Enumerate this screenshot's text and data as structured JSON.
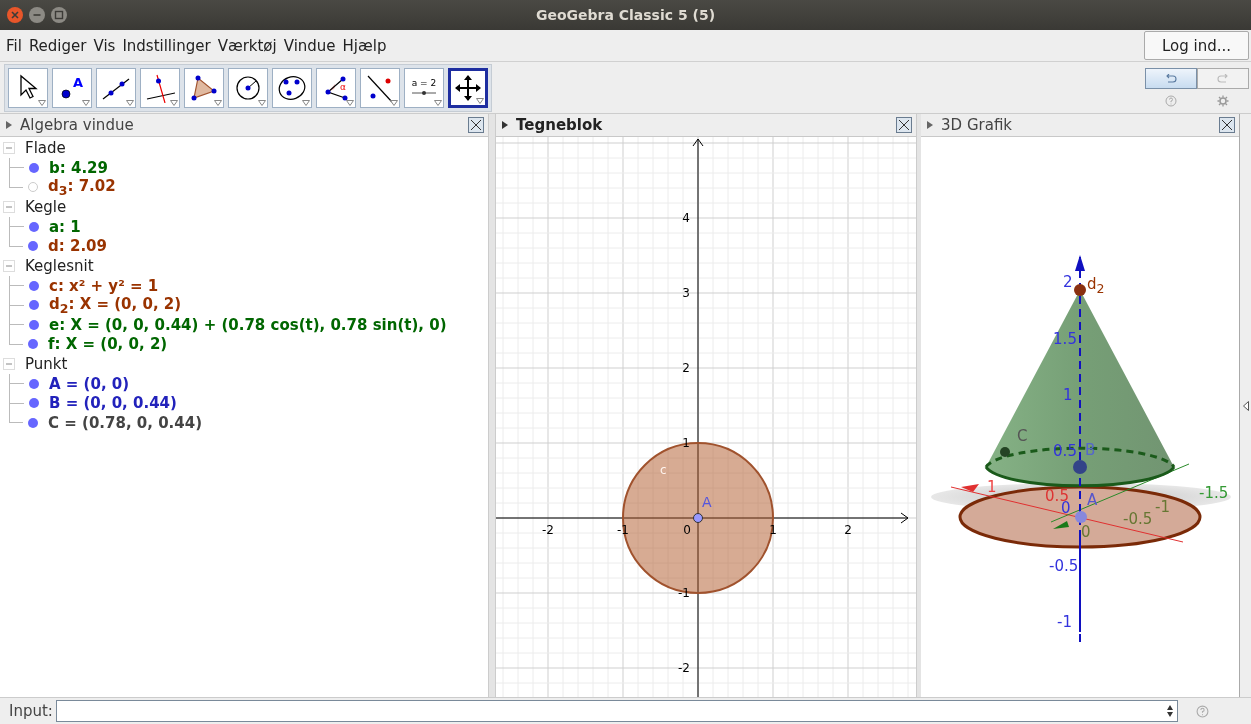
{
  "window": {
    "title": "GeoGebra Classic 5 (5)"
  },
  "menu": [
    "Fil",
    "Rediger",
    "Vis",
    "Indstillinger",
    "Værktøj",
    "Vindue",
    "Hjælp"
  ],
  "login_button": "Log ind...",
  "toolbar": {
    "tools": [
      {
        "kind": "pointer",
        "selected": false
      },
      {
        "kind": "point",
        "label": "A",
        "selected": false
      },
      {
        "kind": "line",
        "selected": false
      },
      {
        "kind": "perpendicular",
        "selected": false
      },
      {
        "kind": "polygon",
        "selected": false
      },
      {
        "kind": "circle",
        "selected": false
      },
      {
        "kind": "conic",
        "selected": false
      },
      {
        "kind": "angle",
        "label": "α",
        "selected": false
      },
      {
        "kind": "reflect",
        "selected": false
      },
      {
        "kind": "slider",
        "label": "a = 2",
        "selected": false
      },
      {
        "kind": "move",
        "selected": true
      }
    ]
  },
  "undo": {
    "disabled": false
  },
  "redo": {
    "disabled": true
  },
  "algebra": {
    "title": "Algebra vindue",
    "groups": [
      {
        "name": "Flade",
        "expanded": true,
        "items": [
          {
            "text": "b: 4.29",
            "color": "#006600",
            "shown": true
          },
          {
            "text": "d$_{3}$: 7.02",
            "color": "#993300",
            "shown": false
          }
        ]
      },
      {
        "name": "Kegle",
        "expanded": true,
        "items": [
          {
            "text": "a: 1",
            "color": "#006600",
            "shown": true
          },
          {
            "text": "d: 2.09",
            "color": "#993300",
            "shown": true
          }
        ]
      },
      {
        "name": "Keglesnit",
        "expanded": true,
        "items": [
          {
            "text": "c: x² + y² = 1",
            "color": "#993300",
            "shown": true
          },
          {
            "text": "d$_{2}$: X = (0, 0, 2)",
            "color": "#993300",
            "shown": true
          },
          {
            "text": "e: X = (0, 0, 0.44) + (0.78 cos(t), 0.78 sin(t), 0)",
            "color": "#006600",
            "shown": true
          },
          {
            "text": "f: X = (0, 0, 2)",
            "color": "#006600",
            "shown": true
          }
        ]
      },
      {
        "name": "Punkt",
        "expanded": true,
        "items": [
          {
            "text": "A = (0, 0)",
            "color": "#2222bb",
            "shown": true
          },
          {
            "text": "B = (0, 0, 0.44)",
            "color": "#2222bb",
            "shown": true
          },
          {
            "text": "C = (0.78, 0, 0.44)",
            "color": "#444444",
            "shown": true
          }
        ]
      }
    ]
  },
  "graphics": {
    "title": "Tegneblok",
    "x_ticks": [
      "-2",
      "-1",
      "1",
      "2"
    ],
    "y_ticks": [
      "4",
      "3",
      "2",
      "1",
      "-1",
      "-2"
    ],
    "origin": "0",
    "point_label": "A",
    "circle_label": "c"
  },
  "graphics3d": {
    "title": "3D Grafik",
    "labels": [
      {
        "text": "2",
        "color": "#3333dd"
      },
      {
        "text": "d$_{2}$",
        "color": "#993300"
      },
      {
        "text": "1.5",
        "color": "#3333dd"
      },
      {
        "text": "1",
        "color": "#3333dd"
      },
      {
        "text": "C",
        "color": "#555555"
      },
      {
        "text": "0.5",
        "color": "#3333dd"
      },
      {
        "text": "B",
        "color": "#5566cc"
      },
      {
        "text": "1",
        "color": "#ee4444"
      },
      {
        "text": "0.5",
        "color": "#dd3333"
      },
      {
        "text": "0",
        "color": "#3333dd"
      },
      {
        "text": "A",
        "color": "#5555cc"
      },
      {
        "text": "-1.5",
        "color": "#339933"
      },
      {
        "text": "-1",
        "color": "#667733"
      },
      {
        "text": "-0.5",
        "color": "#667733"
      },
      {
        "text": "0",
        "color": "#667733"
      },
      {
        "text": "-0.5",
        "color": "#3333dd"
      },
      {
        "text": "-1",
        "color": "#3333dd"
      }
    ]
  },
  "input": {
    "label": "Input:"
  }
}
